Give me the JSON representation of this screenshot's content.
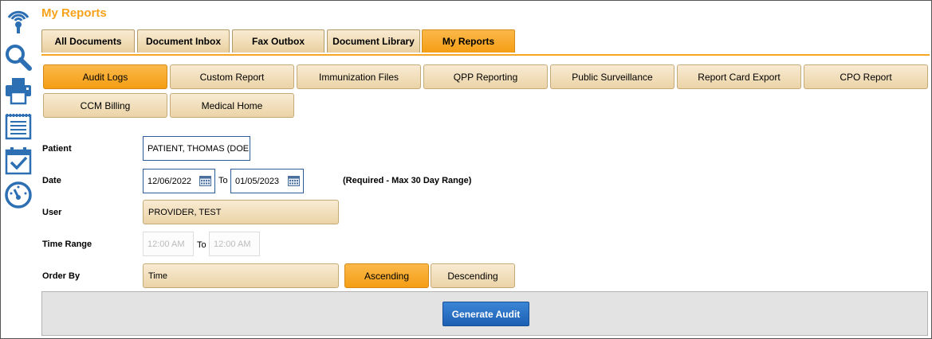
{
  "page": {
    "title": "My Reports"
  },
  "sidebar_icons": [
    "wireless-icon",
    "search-icon",
    "printer-icon",
    "notepad-icon",
    "calendar-check-icon",
    "speedometer-icon"
  ],
  "tabs": [
    {
      "label": "All Documents"
    },
    {
      "label": "Document Inbox"
    },
    {
      "label": "Fax Outbox"
    },
    {
      "label": "Document Library"
    },
    {
      "label": "My Reports",
      "active": true
    }
  ],
  "reports": [
    {
      "label": "Audit Logs",
      "active": true
    },
    {
      "label": "Custom Report"
    },
    {
      "label": "Immunization Files"
    },
    {
      "label": "QPP Reporting"
    },
    {
      "label": "Public Surveillance"
    },
    {
      "label": "Report Card Export"
    },
    {
      "label": "CPO Report"
    },
    {
      "label": "CCM Billing"
    },
    {
      "label": "Medical Home"
    }
  ],
  "form": {
    "patient_label": "Patient",
    "patient_value": "PATIENT, THOMAS (DOE",
    "date_label": "Date",
    "date_from": "12/06/2022",
    "to_label": "To",
    "date_to": "01/05/2023",
    "date_note": "(Required - Max 30 Day Range)",
    "user_label": "User",
    "user_value": "PROVIDER, TEST",
    "time_range_label": "Time Range",
    "time_from": "12:00 AM",
    "time_to": "12:00 AM",
    "order_by_label": "Order By",
    "order_by_value": "Time",
    "ascending_label": "Ascending",
    "descending_label": "Descending"
  },
  "footer": {
    "generate_label": "Generate Audit"
  },
  "colors": {
    "accent": "#f6a623",
    "primary_button": "#1b5fb3",
    "field_border": "#2a5d99"
  }
}
